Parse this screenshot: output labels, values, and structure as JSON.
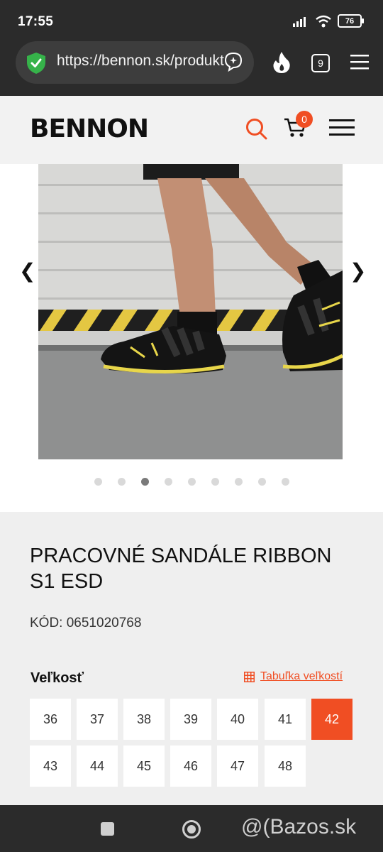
{
  "status": {
    "time": "17:55",
    "battery": "76"
  },
  "browser": {
    "url": "https://bennon.sk/produkt",
    "tab_count": "9"
  },
  "header": {
    "logo": "BENNON",
    "cart_count": "0"
  },
  "gallery": {
    "prev": "❮",
    "next": "❯",
    "slide_count": 9,
    "active_index": 2
  },
  "product": {
    "title": "PRACOVNÉ SANDÁLE RIBBON S1 ESD",
    "code": "KÓD: 0651020768"
  },
  "sizes": {
    "label": "Veľkosť",
    "table_link": "Tabuľka veľkostí",
    "options": [
      "36",
      "37",
      "38",
      "39",
      "40",
      "41",
      "42",
      "43",
      "44",
      "45",
      "46",
      "47",
      "48"
    ],
    "selected": "42"
  },
  "watermark": "@(Bazos.sk",
  "colors": {
    "accent": "#f04e23",
    "dark": "#2b2b2b"
  }
}
